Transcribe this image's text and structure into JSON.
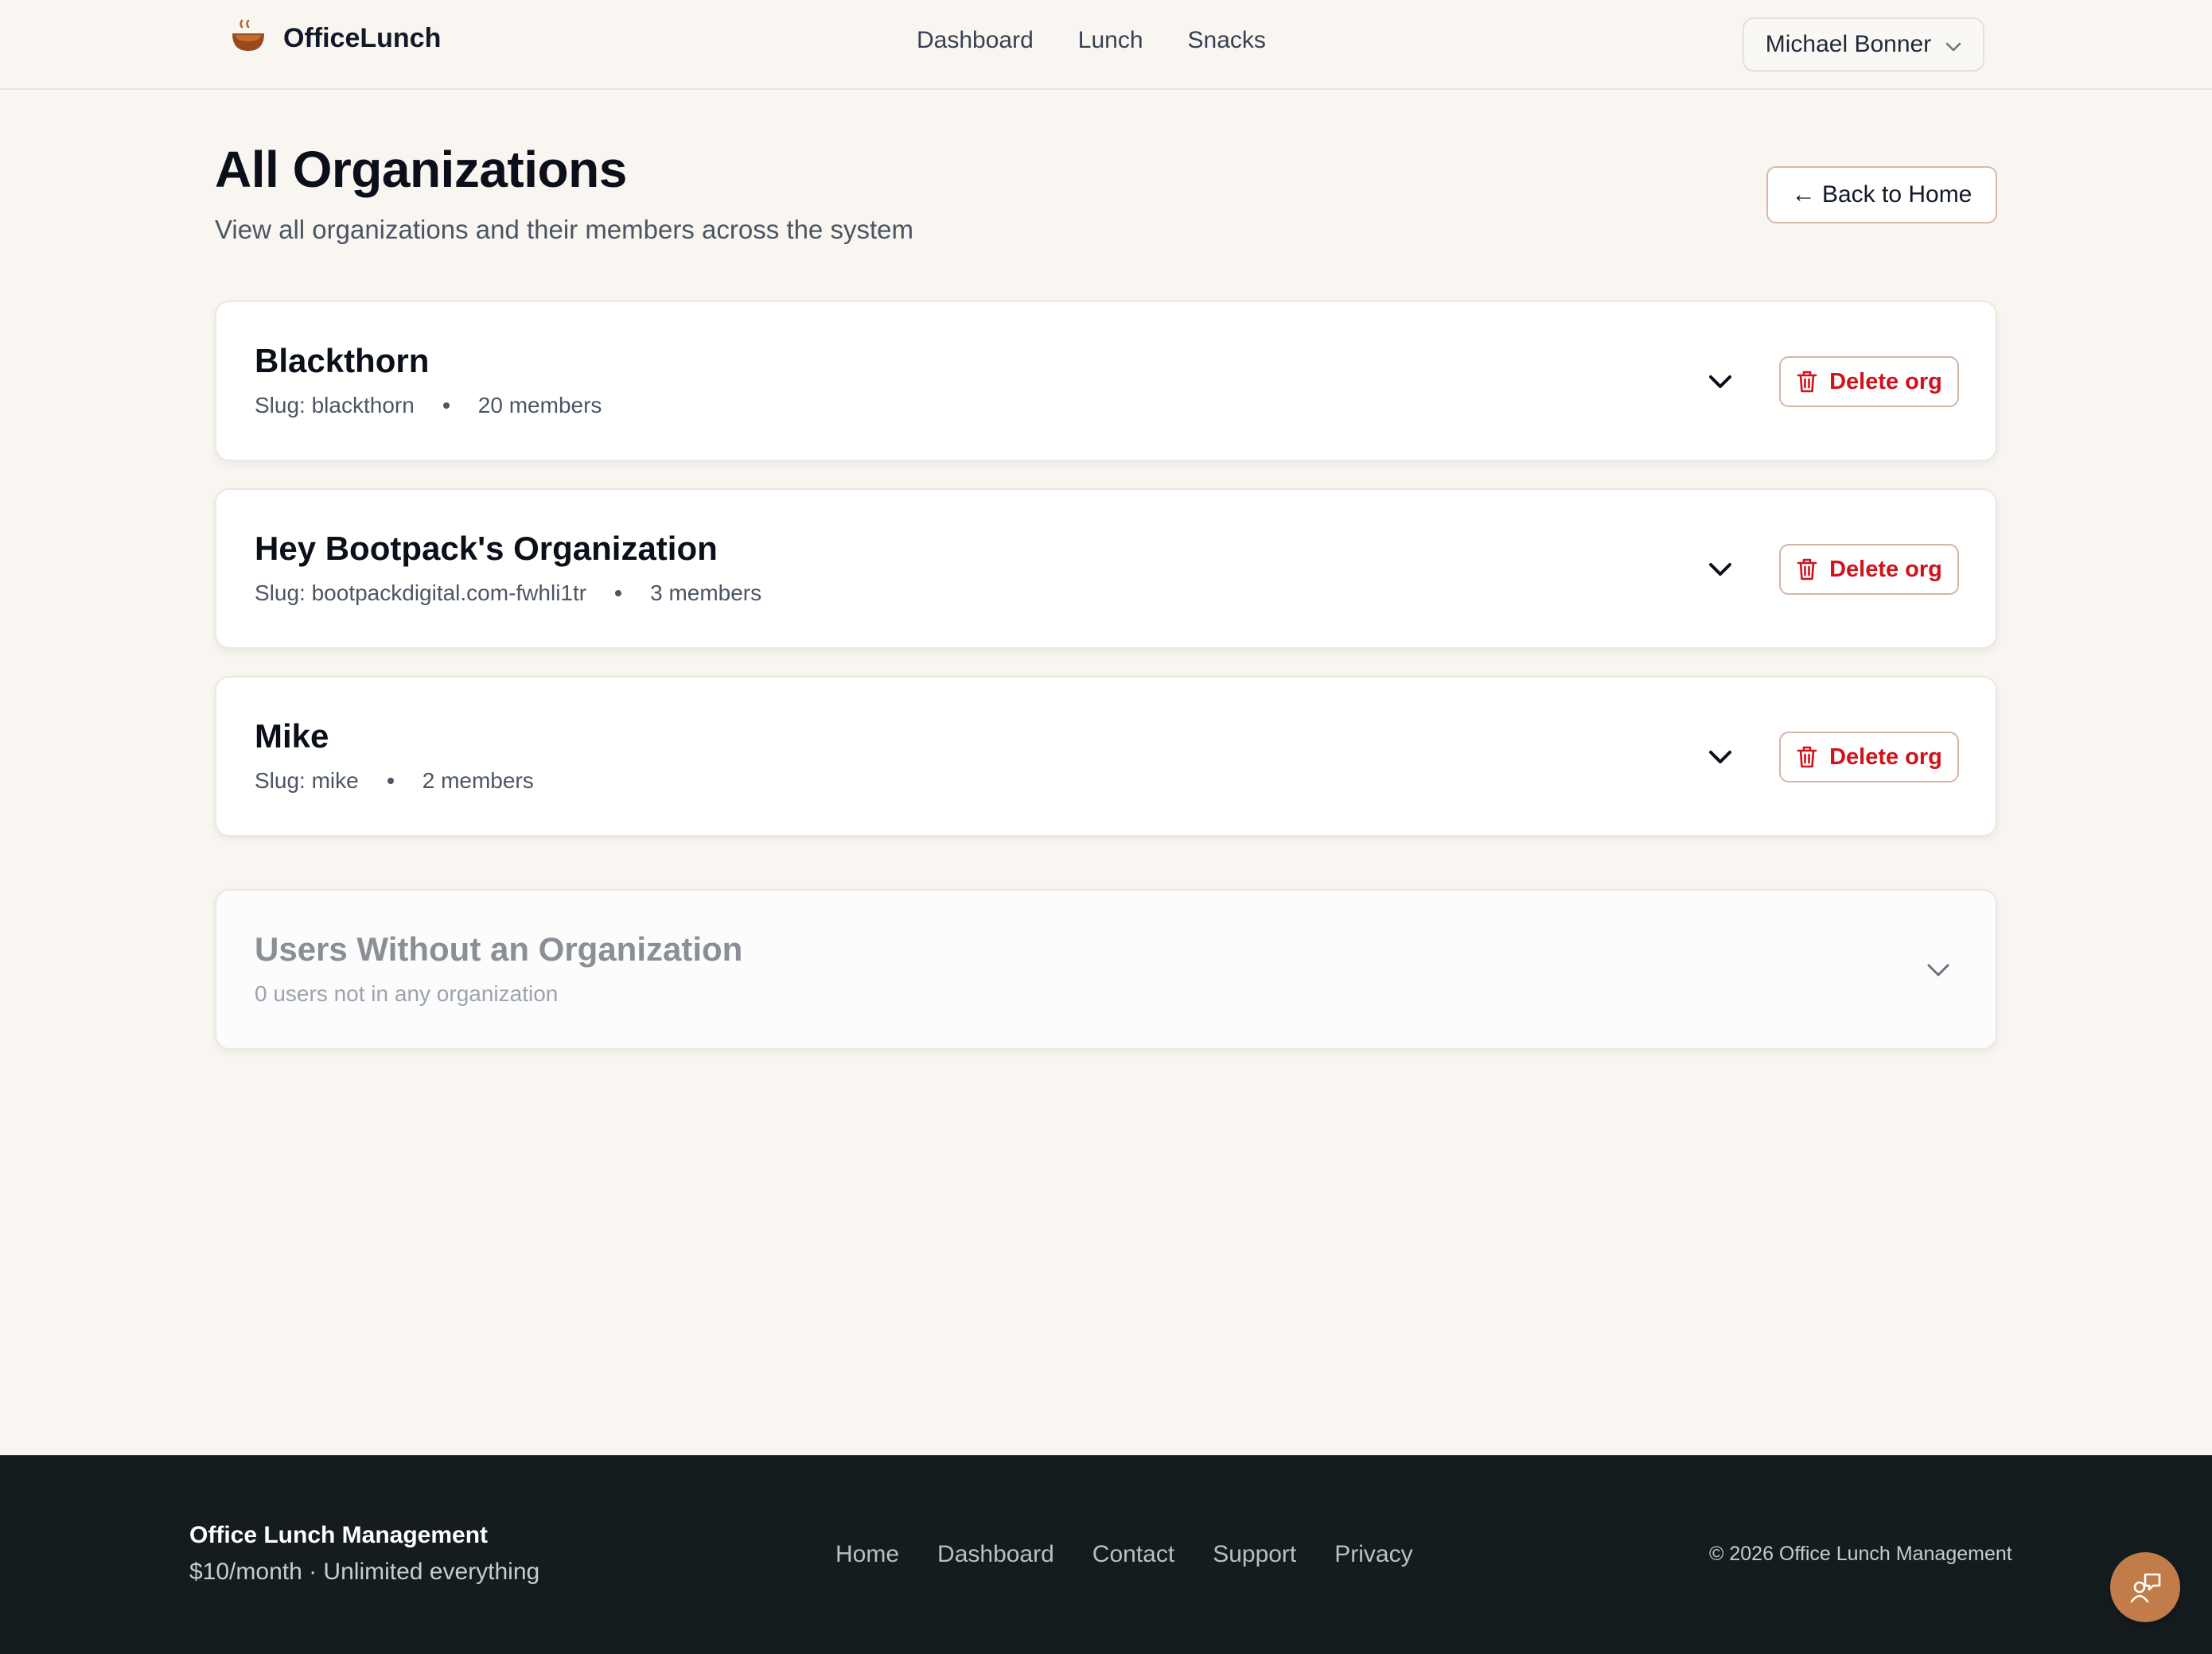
{
  "header": {
    "brand": "OfficeLunch",
    "nav": [
      "Dashboard",
      "Lunch",
      "Snacks"
    ],
    "user_name": "Michael Bonner"
  },
  "page": {
    "title": "All Organizations",
    "subtitle": "View all organizations and their members across the system",
    "back_label": "← Back to Home"
  },
  "organizations": [
    {
      "name": "Blackthorn",
      "slug": "Slug: blackthorn",
      "members": "20 members",
      "delete_label": "Delete org"
    },
    {
      "name": "Hey Bootpack's Organization",
      "slug": "Slug: bootpackdigital.com-fwhli1tr",
      "members": "3 members",
      "delete_label": "Delete org"
    },
    {
      "name": "Mike",
      "slug": "Slug: mike",
      "members": "2 members",
      "delete_label": "Delete org"
    }
  ],
  "unassigned": {
    "title": "Users Without an Organization",
    "subtitle": "0 users not in any organization"
  },
  "footer": {
    "brand": "Office Lunch Management",
    "tagline": "$10/month · Unlimited everything",
    "links": [
      "Home",
      "Dashboard",
      "Contact",
      "Support",
      "Privacy"
    ],
    "copyright": "© 2026 Office Lunch Management"
  },
  "icons": {
    "logo": "coffee-bowl-icon",
    "user_menu": "chevron-down-icon",
    "expand": "chevron-down-icon",
    "delete": "trash-icon",
    "chat": "chat-support-icon"
  },
  "colors": {
    "background": "#f9f6f1",
    "danger": "#d0121b",
    "footer": "#151c1f",
    "accent": "#c17c4a"
  }
}
